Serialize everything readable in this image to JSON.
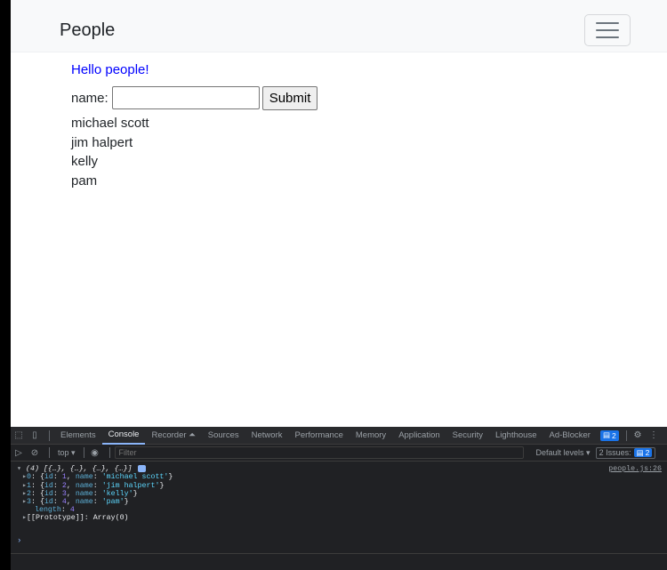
{
  "navbar": {
    "brand": "People"
  },
  "main": {
    "greeting": "Hello people!",
    "form": {
      "label": "name:",
      "input_value": "",
      "submit_label": "Submit"
    },
    "people": [
      "michael scott",
      "jim halpert",
      "kelly",
      "pam"
    ]
  },
  "devtools": {
    "tabs": [
      "Elements",
      "Console",
      "Recorder ⏶",
      "Sources",
      "Network",
      "Performance",
      "Memory",
      "Application",
      "Security",
      "Lighthouse",
      "Ad-Blocker"
    ],
    "active_tab": "Console",
    "message_badge": "2",
    "toolbar": {
      "context": "top ▾",
      "filter_placeholder": "Filter",
      "levels": "Default levels ▾",
      "issues_label": "2 Issues:",
      "issues_count": "2"
    },
    "log": {
      "source": "people.js:26",
      "summary": "(4) [{…}, {…}, {…}, {…}]",
      "rows": [
        {
          "index": "0",
          "id": "1",
          "name": "'michael scott'"
        },
        {
          "index": "1",
          "id": "2",
          "name": "'jim halpert'"
        },
        {
          "index": "2",
          "id": "3",
          "name": "'kelly'"
        },
        {
          "index": "3",
          "id": "4",
          "name": "'pam'"
        }
      ],
      "length_key": "length",
      "length_value": "4",
      "prototype_key": "[[Prototype]]",
      "prototype_value": "Array(0)"
    },
    "prompt": "›"
  },
  "colors": {
    "greeting": "#0000ff",
    "devtools_bg": "#202124",
    "accent": "#1a73e8"
  },
  "icons": [
    "inspect-icon",
    "device-toolbar-icon",
    "gear-icon",
    "kebab-menu-icon",
    "sidebar-toggle-icon",
    "clear-console-icon",
    "eye-icon",
    "info-icon"
  ]
}
